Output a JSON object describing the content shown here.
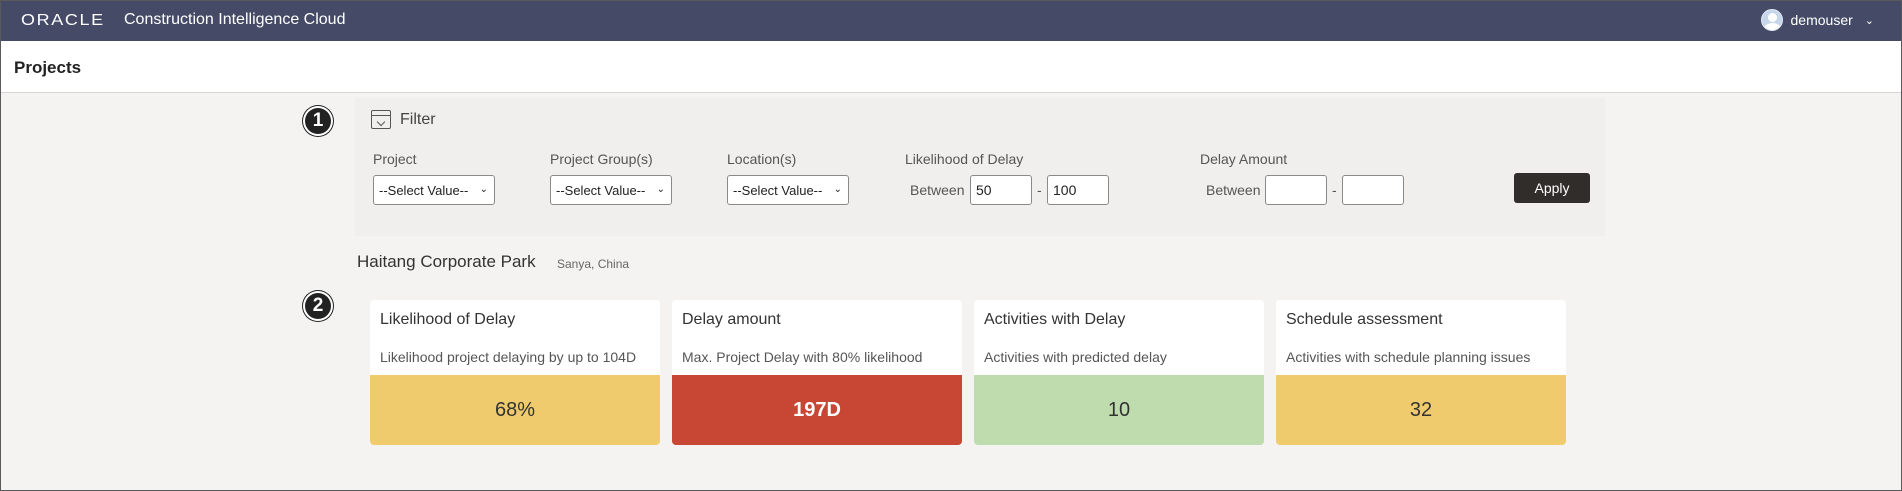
{
  "topbar": {
    "logo": "ORACLE",
    "app_title": "Construction Intelligence Cloud",
    "username": "demouser",
    "bg_color": "#454b66"
  },
  "page": {
    "title": "Projects"
  },
  "steps": {
    "one": "1",
    "two": "2"
  },
  "filter": {
    "heading": "Filter",
    "project": {
      "label": "Project",
      "value": "--Select Value--"
    },
    "project_groups": {
      "label": "Project Group(s)",
      "value": "--Select Value--"
    },
    "locations": {
      "label": "Location(s)",
      "value": "--Select Value--"
    },
    "likelihood": {
      "label": "Likelihood of Delay",
      "between": "Between",
      "min": "50",
      "max": "100",
      "dash": "-"
    },
    "delay_amount": {
      "label": "Delay Amount",
      "between": "Between",
      "min": "",
      "max": "",
      "dash": "-"
    },
    "apply_label": "Apply"
  },
  "project": {
    "name": "Haitang Corporate Park",
    "location": "Sanya, China"
  },
  "cards": [
    {
      "title": "Likelihood of Delay",
      "subtitle": "Likelihood project delaying by up to 104D",
      "value": "68%",
      "color": "#efcb6e"
    },
    {
      "title": "Delay amount",
      "subtitle": "Max. Project Delay with 80% likelihood",
      "value": "197D",
      "color": "#c74634"
    },
    {
      "title": "Activities with Delay",
      "subtitle": "Activities with predicted delay",
      "value": "10",
      "color": "#bfdcae"
    },
    {
      "title": "Schedule assessment",
      "subtitle": "Activities with schedule planning issues",
      "value": "32",
      "color": "#efcb6e"
    }
  ]
}
